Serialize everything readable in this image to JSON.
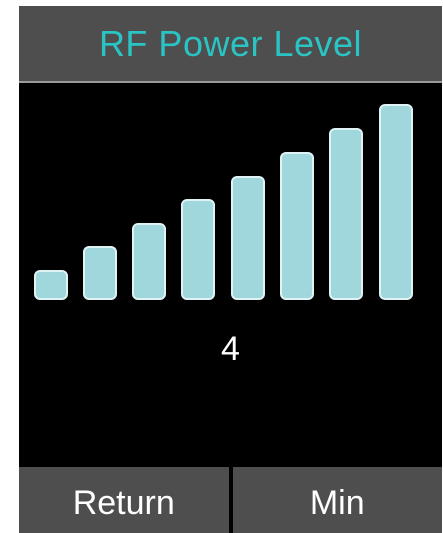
{
  "screen": {
    "title": "RF Power Level",
    "title_color": "#2bc4c4",
    "background_color": "#000000",
    "header_color": "#4e4e4e"
  },
  "power_level": {
    "value": "4",
    "bar_count": 8,
    "bar_color": "#9fd7dc"
  },
  "softkeys": {
    "left_label": "Return",
    "right_label": "Min"
  }
}
